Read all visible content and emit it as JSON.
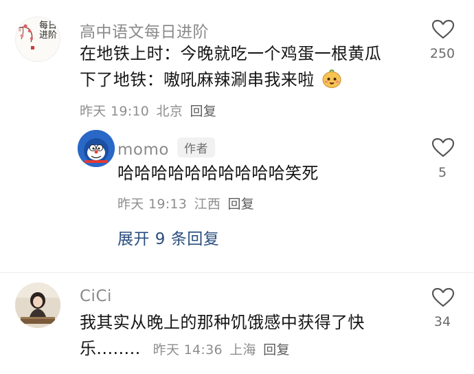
{
  "comments": [
    {
      "username": "高中语文每日进阶",
      "avatar_text": "每日进阶",
      "line1": "在地铁上时：今晚就吃一个鸡蛋一根黄瓜",
      "line2": "下了地铁：嗷吼麻辣涮串我来啦",
      "emoji": "smiling-face-emoji",
      "time": "昨天 19:10",
      "location": "北京",
      "reply_label": "回复",
      "likes": "250",
      "replies": [
        {
          "username": "momo",
          "author_tag": "作者",
          "text": "哈哈哈哈哈哈哈哈哈哈笑死",
          "time": "昨天 19:13",
          "location": "江西",
          "reply_label": "回复",
          "likes": "5"
        }
      ],
      "expand_label": "展开 9 条回复"
    },
    {
      "username": "CiCi",
      "line1": "我其实从晚上的那种饥饿感中获得了快",
      "line2": "乐........",
      "time": "昨天 14:36",
      "location": "上海",
      "reply_label": "回复",
      "likes": "34"
    }
  ],
  "colors": {
    "username": "#8a8a8a",
    "meta": "#8e8e8e",
    "expand_link": "#2b4e7e",
    "author_tag_bg": "#f1f1f1"
  }
}
